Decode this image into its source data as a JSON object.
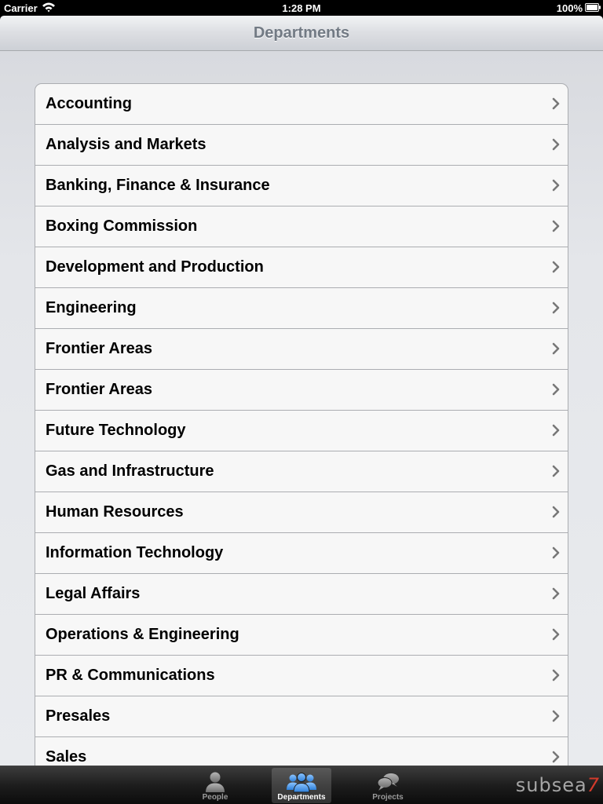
{
  "status_bar": {
    "carrier": "Carrier",
    "time": "1:28 PM",
    "battery": "100%"
  },
  "nav": {
    "title": "Departments"
  },
  "departments": [
    "Accounting",
    "Analysis and Markets",
    "Banking, Finance & Insurance",
    "Boxing Commission",
    "Development and Production",
    "Engineering",
    "Frontier Areas",
    "Frontier Areas",
    "Future Technology",
    "Gas and Infrastructure",
    "Human Resources",
    "Information Technology",
    "Legal Affairs",
    "Operations & Engineering",
    "PR & Communications",
    "Presales",
    "Sales"
  ],
  "tab_bar": {
    "tabs": [
      {
        "label": "People",
        "icon": "person-icon",
        "selected": false
      },
      {
        "label": "Departments",
        "icon": "group-icon",
        "selected": true
      },
      {
        "label": "Projects",
        "icon": "speech-bubbles-icon",
        "selected": false
      }
    ],
    "brand_text": "subsea",
    "brand_mark": "7"
  },
  "colors": {
    "accent_selected_icon": "#5a9be0",
    "brand_red": "#d23a2b",
    "nav_title": "#727a84"
  }
}
